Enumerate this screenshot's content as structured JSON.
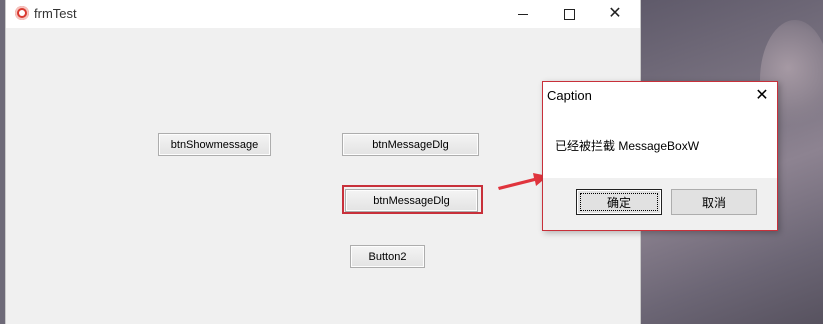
{
  "window": {
    "title": "frmTest",
    "controls": {
      "minimize": "minimize-icon",
      "maximize": "maximize-icon",
      "close": "close-icon"
    }
  },
  "form": {
    "btn_showmessage": "btnShowmessage",
    "btn_messagedlg_1": "btnMessageDlg",
    "btn_messagedlg_2": "btnMessageDlg",
    "button2": "Button2"
  },
  "dialog": {
    "caption": "Caption",
    "message": "已经被拦截 MessageBoxW",
    "ok_label": "确定",
    "cancel_label": "取消",
    "close_glyph": "✕"
  },
  "colors": {
    "highlight": "#c8303a",
    "arrow": "#e0343d"
  }
}
